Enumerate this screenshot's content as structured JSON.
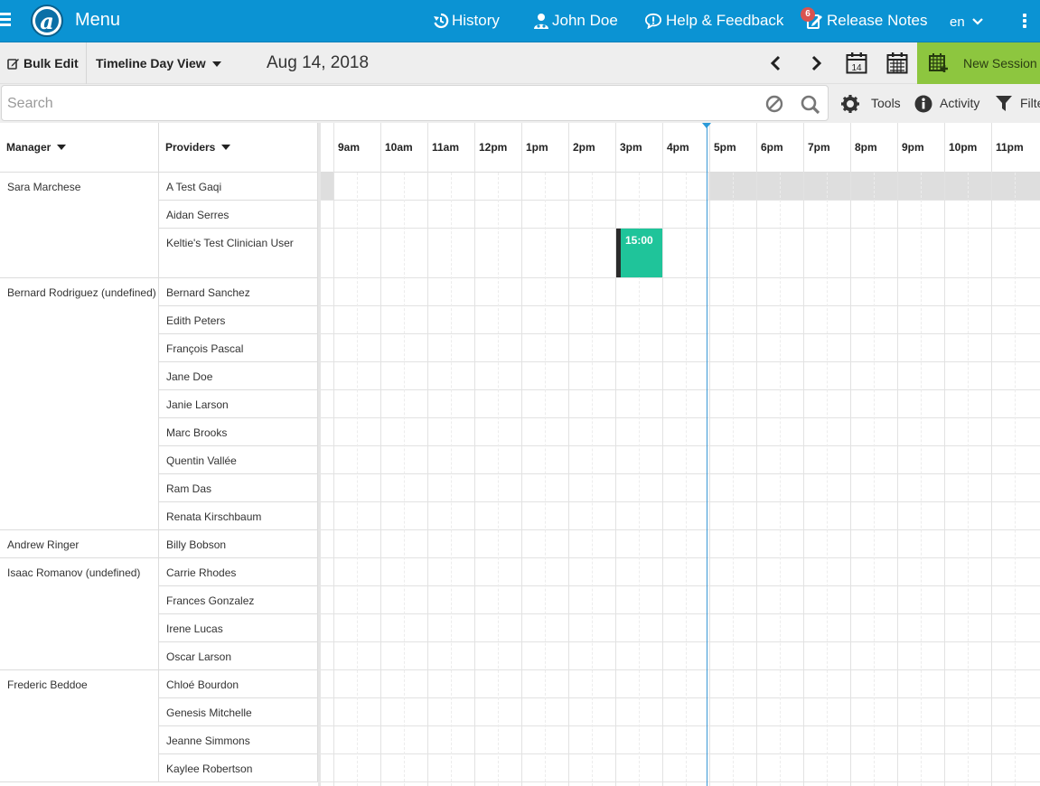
{
  "topnav": {
    "menu_label": "Menu",
    "logo_letter": "a",
    "history_label": "History",
    "user_label": "John Doe",
    "help_label": "Help & Feedback",
    "release_notes_label": "Release Notes",
    "release_notes_badge": "6",
    "language_label": "en",
    "accent_color": "#0b93d3"
  },
  "toolbar": {
    "bulk_edit_label": "Bulk Edit",
    "view_label": "Timeline Day View",
    "date_label": "Aug 14, 2018",
    "calendar_day_number": "14",
    "new_session_label": "New Session",
    "new_session_color": "#8dc63f"
  },
  "search": {
    "placeholder": "Search",
    "tools_label": "Tools",
    "activity_label": "Activity",
    "filter_label": "Filter"
  },
  "grid": {
    "manager_header": "Manager",
    "providers_header": "Providers",
    "hours": [
      "9am",
      "10am",
      "11am",
      "12pm",
      "1pm",
      "2pm",
      "3pm",
      "4pm",
      "5pm",
      "6pm",
      "7pm",
      "8pm",
      "9pm",
      "10pm",
      "11pm"
    ],
    "groups": [
      {
        "manager": "Sara Marchese",
        "providers": [
          "A Test Gaqi",
          "Aidan Serres",
          "Keltie's Test Clinician User"
        ]
      },
      {
        "manager": "Bernard Rodriguez (undefined)",
        "providers": [
          "Bernard Sanchez",
          "Edith Peters",
          "François Pascal",
          "Jane Doe",
          "Janie Larson",
          "Marc Brooks",
          "Quentin Vallée",
          "Ram Das",
          "Renata Kirschbaum"
        ]
      },
      {
        "manager": "Andrew Ringer",
        "providers": [
          "Billy Bobson"
        ]
      },
      {
        "manager": "Isaac Romanov (undefined)",
        "providers": [
          "Carrie Rhodes",
          "Frances Gonzalez",
          "Irene Lucas",
          "Oscar Larson"
        ]
      },
      {
        "manager": "Frederic Beddoe",
        "providers": [
          "Chloé Bourdon",
          "Genesis Mitchelle",
          "Jeanne Simmons",
          "Kaylee Robertson"
        ]
      }
    ],
    "session": {
      "time_label": "15:00",
      "provider": "Keltie's Test Clinician User",
      "color": "#1fc49a"
    }
  }
}
